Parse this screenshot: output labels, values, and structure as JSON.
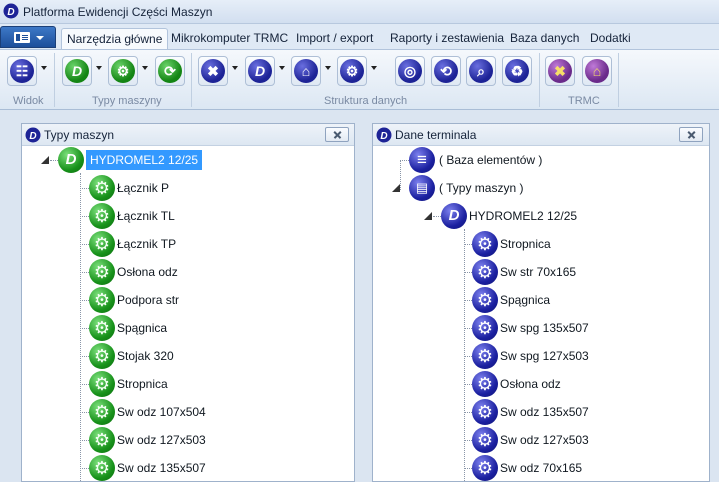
{
  "window": {
    "title": "Platforma Ewidencji Części Maszyn"
  },
  "tabs": [
    {
      "label": "Narzędzia główne",
      "active": true
    },
    {
      "label": "Mikrokomputer TRMC",
      "active": false
    },
    {
      "label": "Import / export",
      "active": false
    },
    {
      "label": "Raporty i zestawienia",
      "active": false
    },
    {
      "label": "Baza danych",
      "active": false
    },
    {
      "label": "Dodatki",
      "active": false
    }
  ],
  "ribbon": {
    "groups": [
      {
        "label": "Widok"
      },
      {
        "label": "Typy maszyny"
      },
      {
        "label": "Struktura danych"
      },
      {
        "label": "TRMC"
      }
    ]
  },
  "left_panel": {
    "title": "Typy maszyn",
    "root": "HYDROMEL2 12/25",
    "items": [
      "Łącznik P",
      "Łącznik TL",
      "Łącznik TP",
      "Osłona odz",
      "Podpora str",
      "Spągnica",
      "Stojak 320",
      "Stropnica",
      "Sw odz 107x504",
      "Sw odz 127x503",
      "Sw odz 135x507"
    ]
  },
  "right_panel": {
    "title": "Dane terminala",
    "db_node": "( Baza elementów )",
    "types_node": "( Typy maszyn )",
    "root": "HYDROMEL2 12/25",
    "items": [
      "Stropnica",
      "Sw str 70x165",
      "Spągnica",
      "Sw spg 135x507",
      "Sw spg 127x503",
      "Osłona odz",
      "Sw odz 135x507",
      "Sw odz 127x503",
      "Sw odz 70x165"
    ]
  },
  "colors": {
    "selection": "#3399ff",
    "accent_blue": "#1d2396",
    "accent_green": "#17911a"
  }
}
